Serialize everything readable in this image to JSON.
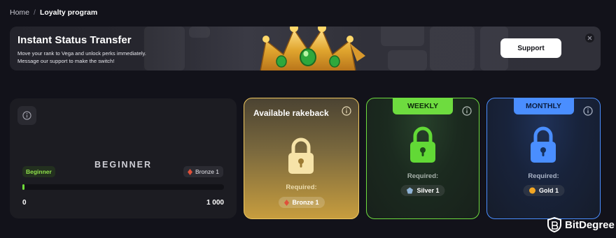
{
  "breadcrumb": {
    "home": "Home",
    "separator": "/",
    "current": "Loyalty program"
  },
  "banner": {
    "title": "Instant Status Transfer",
    "description_line1": "Move your rank to Vega and unlock perks immediately.",
    "description_line2": "Message our support to make the switch!",
    "support_label": "Support",
    "close_icon": "close-icon",
    "image_icon": "crown-icon"
  },
  "beginner_card": {
    "info_icon": "info-icon",
    "level_title": "BEGINNER",
    "current_tag": "Beginner",
    "next_tag": "Bronze 1",
    "progress": 0,
    "min_value": "0",
    "max_value": "1 000"
  },
  "rakeback_card": {
    "title": "Available rakeback",
    "info_icon": "info-icon",
    "lock_icon": "lock-icon",
    "required_label": "Required:",
    "required_rank": "Bronze 1",
    "accent": "#f0c860"
  },
  "weekly_card": {
    "tab_label": "WEEKLY",
    "info_icon": "info-icon",
    "lock_icon": "lock-icon",
    "required_label": "Required:",
    "required_rank": "Silver 1",
    "accent": "#6edc3f"
  },
  "monthly_card": {
    "tab_label": "MONTHLY",
    "info_icon": "info-icon",
    "lock_icon": "lock-icon",
    "required_label": "Required:",
    "required_rank": "Gold 1",
    "accent": "#4a8eff"
  },
  "watermark": {
    "brand": "BitDegree"
  }
}
